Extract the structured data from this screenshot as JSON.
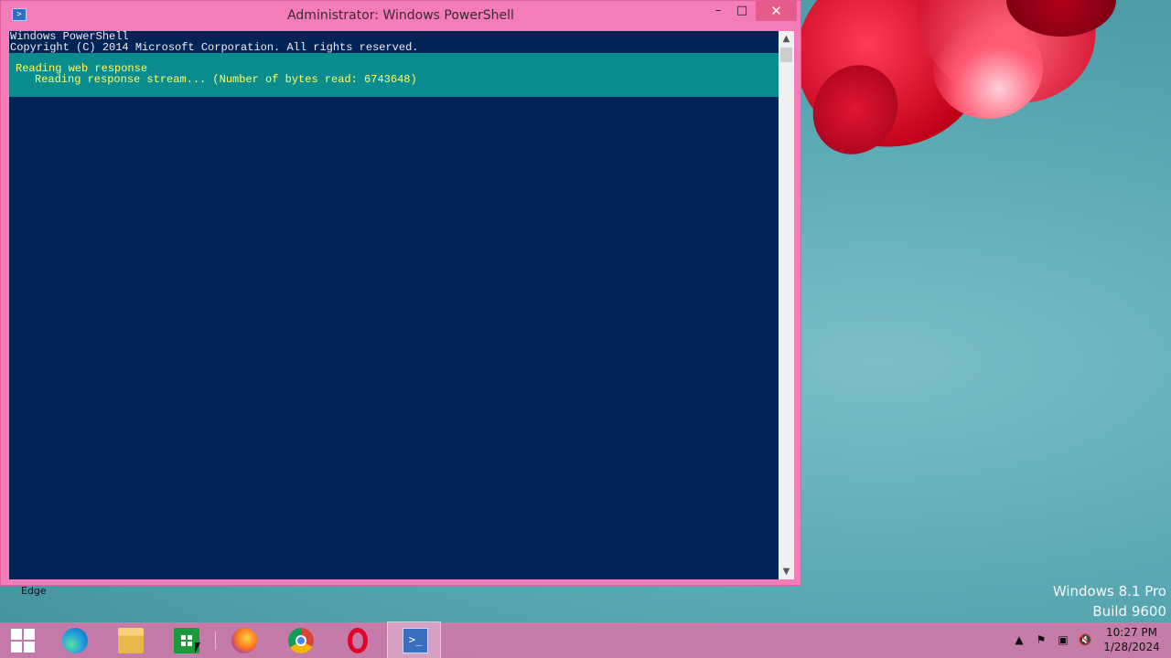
{
  "desktop": {
    "os_name": "Windows 8.1 Pro",
    "build": "Build 9600"
  },
  "window": {
    "title": "Administrator: Windows PowerShell",
    "icon": "powershell-icon",
    "controls": {
      "minimize": "–",
      "maximize": "□",
      "close": "✕"
    }
  },
  "console": {
    "lines": [
      "Windows PowerShell",
      "Copyright (C) 2014 Microsoft Corporation. All rights reserved."
    ],
    "progress": {
      "activity": "Reading web response",
      "status": "Reading response stream... (Number of bytes read: 6743648)"
    }
  },
  "tooltip": "Edge",
  "taskbar": {
    "items": [
      {
        "name": "Start",
        "icon": "windows-logo-icon"
      },
      {
        "name": "Microsoft Edge",
        "icon": "edge-icon"
      },
      {
        "name": "File Explorer",
        "icon": "folder-icon"
      },
      {
        "name": "Store",
        "icon": "store-icon"
      },
      {
        "name": "Firefox",
        "icon": "firefox-icon"
      },
      {
        "name": "Google Chrome",
        "icon": "chrome-icon"
      },
      {
        "name": "Opera",
        "icon": "opera-icon"
      },
      {
        "name": "Windows PowerShell",
        "icon": "powershell-icon",
        "active": true
      }
    ],
    "tray": {
      "icons": [
        "chevron-up-icon",
        "action-center-flag-icon",
        "network-icon",
        "volume-muted-icon"
      ],
      "time": "10:27 PM",
      "date": "1/28/2024"
    }
  },
  "colors": {
    "console_bg": "#012456",
    "progress_bg": "#0b8c8f",
    "progress_text": "#ffff66",
    "window_frame": "#f47cb8"
  }
}
